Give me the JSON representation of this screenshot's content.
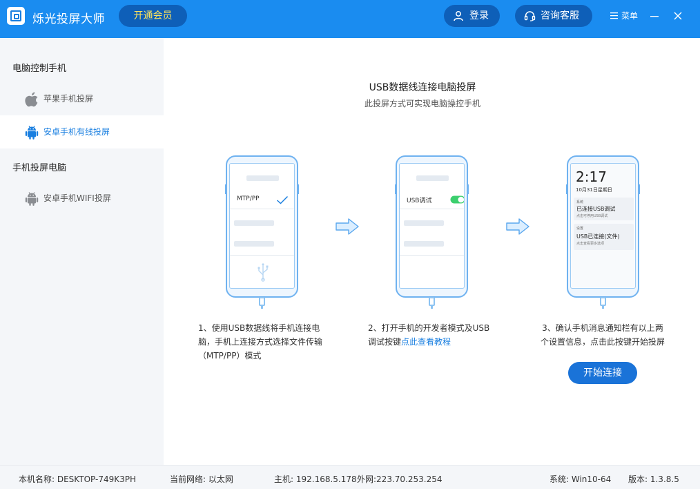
{
  "app": {
    "title": "烁光投屏大师"
  },
  "header": {
    "vip_label": "开通会员",
    "login_label": "登录",
    "service_label": "咨询客服",
    "menu_label": "菜单"
  },
  "sidebar": {
    "group1": "电脑控制手机",
    "item_apple": "苹果手机投屏",
    "item_android_wired": "安卓手机有线投屏",
    "group2": "手机投屏电脑",
    "item_android_wifi": "安卓手机WIFI投屏"
  },
  "main": {
    "title": "USB数据线连接电脑投屏",
    "subtitle": "此投屏方式可实现电脑操控手机",
    "phone1": {
      "option": "MTP/PP"
    },
    "phone2": {
      "option": "USB调试"
    },
    "phone3": {
      "time": "2:17",
      "date": "10月31日星期日",
      "n1_header": "系统",
      "n1_title": "已连接USB调试",
      "n1_sub": "点击可停用USB调试",
      "n2_header": "设置",
      "n2_title": "USB已连接(文件)",
      "n2_sub": "点击查看更多选项"
    },
    "step1": "1、使用USB数据线将手机连接电脑，手机上连接方式选择文件传输（MTP/PP）模式",
    "step2_prefix": "2、打开手机的开发者模式及USB调试按键",
    "step2_link": "点此查看教程",
    "step3": "3、确认手机消息通知栏有以上两个设置信息，点击此按键开始投屏",
    "start_label": "开始连接"
  },
  "status": {
    "computer": "本机名称: DESKTOP-749K3PH",
    "network": "当前网络: 以太网",
    "host": "主机: 192.168.5.178",
    "external": "外网:223.70.253.254",
    "system": "系统: Win10-64",
    "version": "版本: 1.3.8.5"
  },
  "colors": {
    "header_bg": "#1a8cf0",
    "pill_bg": "#0e5fb8",
    "vip_text": "#ffe45c",
    "accent": "#1a7fe0",
    "toggle_on": "#3ccf6e"
  }
}
